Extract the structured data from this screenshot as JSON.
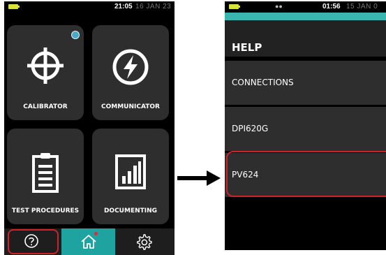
{
  "left_screen": {
    "time": "21:05",
    "date": "16 JAN 23",
    "tiles": [
      {
        "label": "CALIBRATOR",
        "icon": "crosshair-icon"
      },
      {
        "label": "COMMUNICATOR",
        "icon": "lightning-bolt-icon"
      },
      {
        "label": "TEST PROCEDURES",
        "icon": "clipboard-icon"
      },
      {
        "label": "DOCUMENTING",
        "icon": "bar-chart-document-icon"
      }
    ],
    "navbar": {
      "help_icon": "help-icon",
      "home_icon": "home-icon",
      "settings_icon": "gear-icon"
    }
  },
  "right_screen": {
    "time": "01:56",
    "date": "15 JAN 0",
    "title": "HELP",
    "items": [
      "CONNECTIONS",
      "DPI620G",
      "PV624"
    ],
    "selected": "PV624"
  },
  "colors": {
    "accent": "#3bb5b0",
    "nav_home": "#1fa3a0",
    "highlight": "#d0202a",
    "notification": "#4aa9c8",
    "battery": "#d8e33a"
  }
}
